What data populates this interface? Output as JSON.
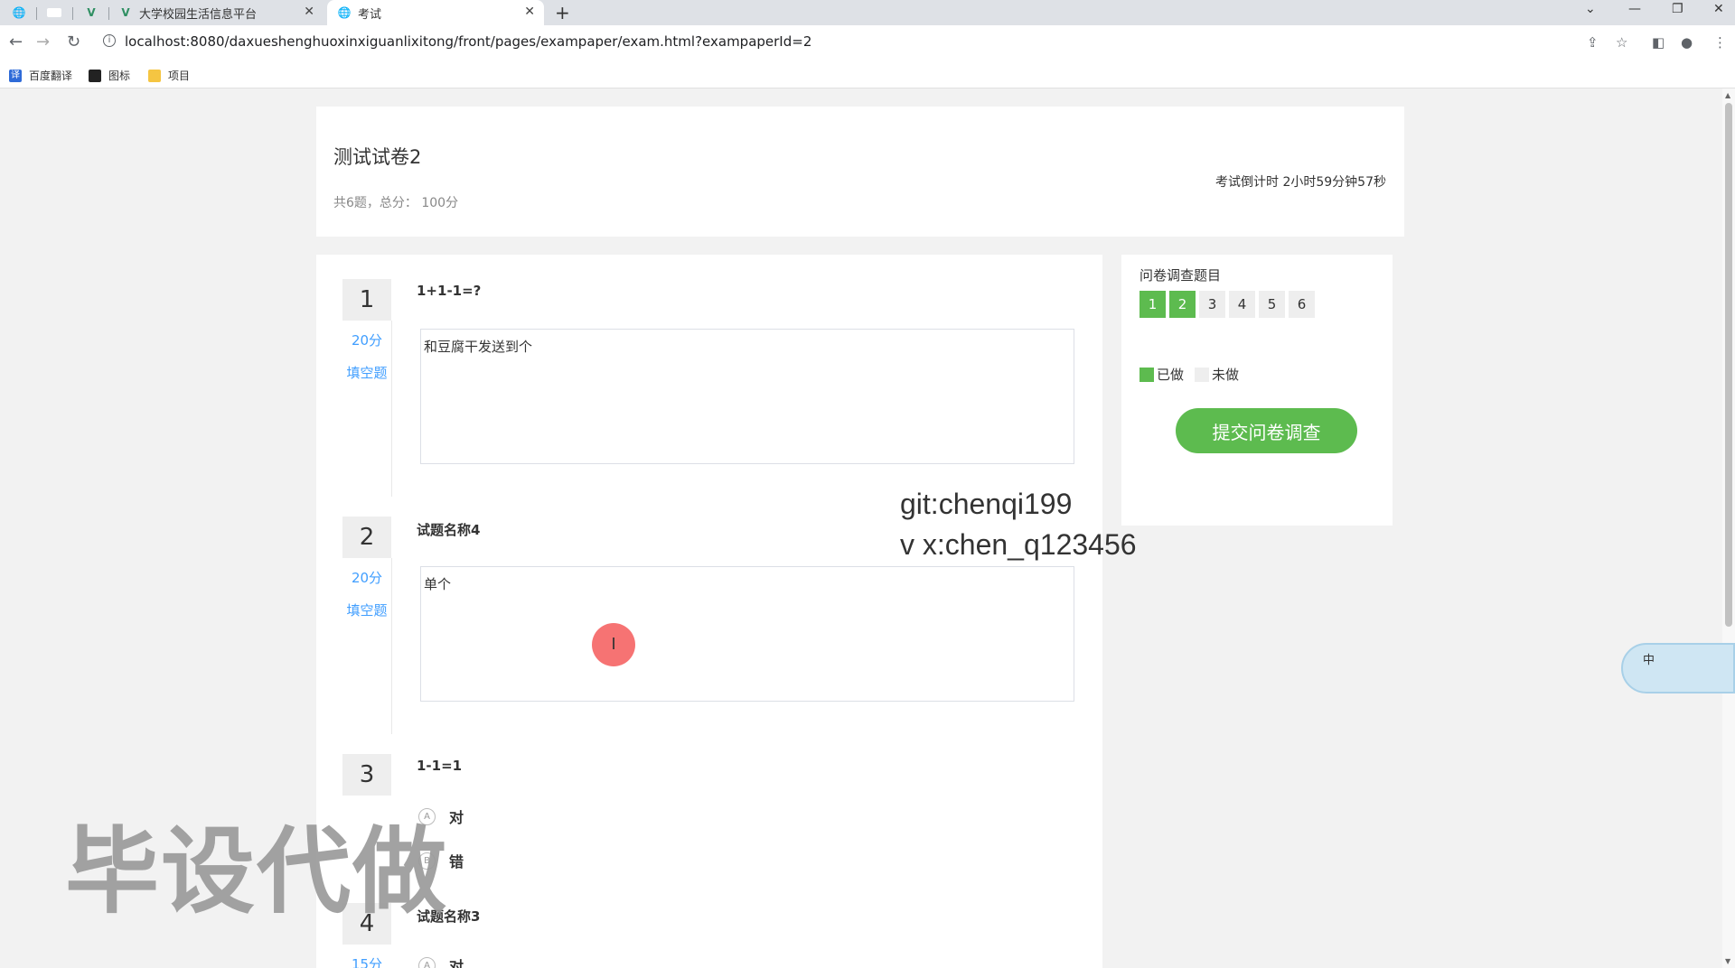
{
  "browser": {
    "tabs": [
      {
        "label": "大学校园生活信息平台"
      },
      {
        "label": "考试"
      }
    ],
    "url": "localhost:8080/daxueshenghuoxinxiguanlixitong/front/pages/exampaper/exam.html?exampaperId=2",
    "bookmarks": [
      "百度翻译",
      "图标",
      "项目"
    ],
    "new_tab": "+"
  },
  "exam": {
    "title": "测试试卷2",
    "summary": "共6题，总分： 100分",
    "countdown": "考试倒计时 2小时59分钟57秒"
  },
  "questions": [
    {
      "num": "1",
      "score": "20分",
      "type": "填空题",
      "text": "1+1-1=?",
      "answer": "和豆腐干发送到个"
    },
    {
      "num": "2",
      "score": "20分",
      "type": "填空题",
      "text": "试题名称4",
      "answer": "单个"
    },
    {
      "num": "3",
      "text": "1-1=1",
      "options": [
        {
          "letter": "A",
          "label": "对"
        },
        {
          "letter": "B",
          "label": "错"
        }
      ]
    },
    {
      "num": "4",
      "score": "15分",
      "text": "试题名称3",
      "options": [
        {
          "letter": "A",
          "label": "对"
        }
      ]
    }
  ],
  "sidebar": {
    "title": "问卷调查题目",
    "nav": [
      "1",
      "2",
      "3",
      "4",
      "5",
      "6"
    ],
    "done_label": "已做",
    "undone_label": "未做",
    "submit_label": "提交问卷调查"
  },
  "overlays": {
    "git": "git:chenqi199",
    "vx": "v x:chen_q123456",
    "big_watermark": "毕设代做",
    "ime_label": "中"
  },
  "colors": {
    "accent_green": "#5dbb4f",
    "link_blue": "#409eff"
  }
}
